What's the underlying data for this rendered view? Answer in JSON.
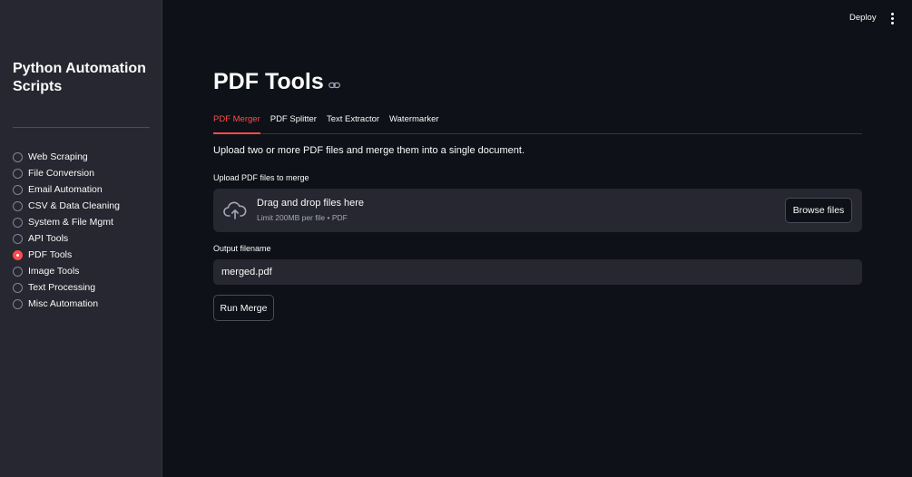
{
  "sidebar": {
    "title": "Python Automation Scripts",
    "items": [
      {
        "label": "Web Scraping",
        "selected": false
      },
      {
        "label": "File Conversion",
        "selected": false
      },
      {
        "label": "Email Automation",
        "selected": false
      },
      {
        "label": "CSV & Data Cleaning",
        "selected": false
      },
      {
        "label": "System & File Mgmt",
        "selected": false
      },
      {
        "label": "API Tools",
        "selected": false
      },
      {
        "label": "PDF Tools",
        "selected": true
      },
      {
        "label": "Image Tools",
        "selected": false
      },
      {
        "label": "Text Processing",
        "selected": false
      },
      {
        "label": "Misc Automation",
        "selected": false
      }
    ]
  },
  "topbar": {
    "deploy_label": "Deploy",
    "menu_icon": "vertical-ellipsis-icon"
  },
  "main": {
    "title": "PDF Tools",
    "tabs": [
      {
        "label": "PDF Merger",
        "active": true
      },
      {
        "label": "PDF Splitter",
        "active": false
      },
      {
        "label": "Text Extractor",
        "active": false
      },
      {
        "label": "Watermarker",
        "active": false
      }
    ],
    "description": "Upload two or more PDF files and merge them into a single document.",
    "upload": {
      "label": "Upload PDF files to merge",
      "drop_title": "Drag and drop files here",
      "drop_subtitle": "Limit 200MB per file • PDF",
      "browse_label": "Browse files"
    },
    "output": {
      "label": "Output filename",
      "value": "merged.pdf"
    },
    "run_label": "Run Merge"
  },
  "colors": {
    "accent": "#ff4b4b",
    "background": "#0e1117",
    "sidebar": "#262730"
  }
}
